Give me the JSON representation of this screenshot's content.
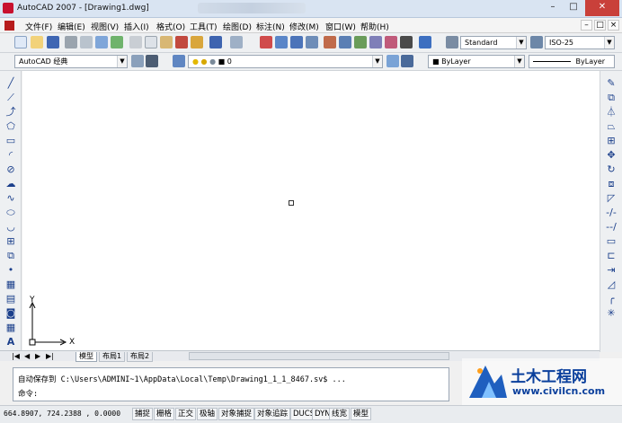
{
  "window": {
    "title": "AutoCAD 2007 - [Drawing1.dwg]",
    "controls": [
      "–",
      "□",
      "✕"
    ]
  },
  "menubar": {
    "items": [
      "文件(F)",
      "编辑(E)",
      "视图(V)",
      "插入(I)",
      "格式(O)",
      "工具(T)",
      "绘图(D)",
      "标注(N)",
      "修改(M)",
      "窗口(W)",
      "帮助(H)"
    ],
    "mdi_controls": [
      "–",
      "□",
      "×"
    ]
  },
  "toolbar2": {
    "workspace": "AutoCAD 经典",
    "layer_value": "0"
  },
  "toolbar1": {
    "text_style": "Standard",
    "dim_style": "ISO-25"
  },
  "properties": {
    "color": "ByLayer",
    "linetype": "ByLayer"
  },
  "layout_tabs": [
    "模型",
    "布局1",
    "布局2"
  ],
  "command": {
    "line1": "自动保存到 C:\\Users\\ADMINI~1\\AppData\\Local\\Temp\\Drawing1_1_1_8467.sv$ ...",
    "prompt": "命令:"
  },
  "status": {
    "coords": "664.8907,  724.2388 , 0.0000",
    "buttons": [
      "捕捉",
      "栅格",
      "正交",
      "极轴",
      "对象捕捉",
      "对象追踪",
      "DUCS",
      "DYN",
      "线宽",
      "模型"
    ]
  },
  "ucs": {
    "x_label": "X",
    "y_label": "Y"
  },
  "watermark": {
    "title": "土木工程网",
    "url": "www.civilcn.com"
  },
  "colors": {
    "accent": "#1f5fbf",
    "canvas": "#ffffff",
    "watermark_blue": "#0a3f9c"
  }
}
